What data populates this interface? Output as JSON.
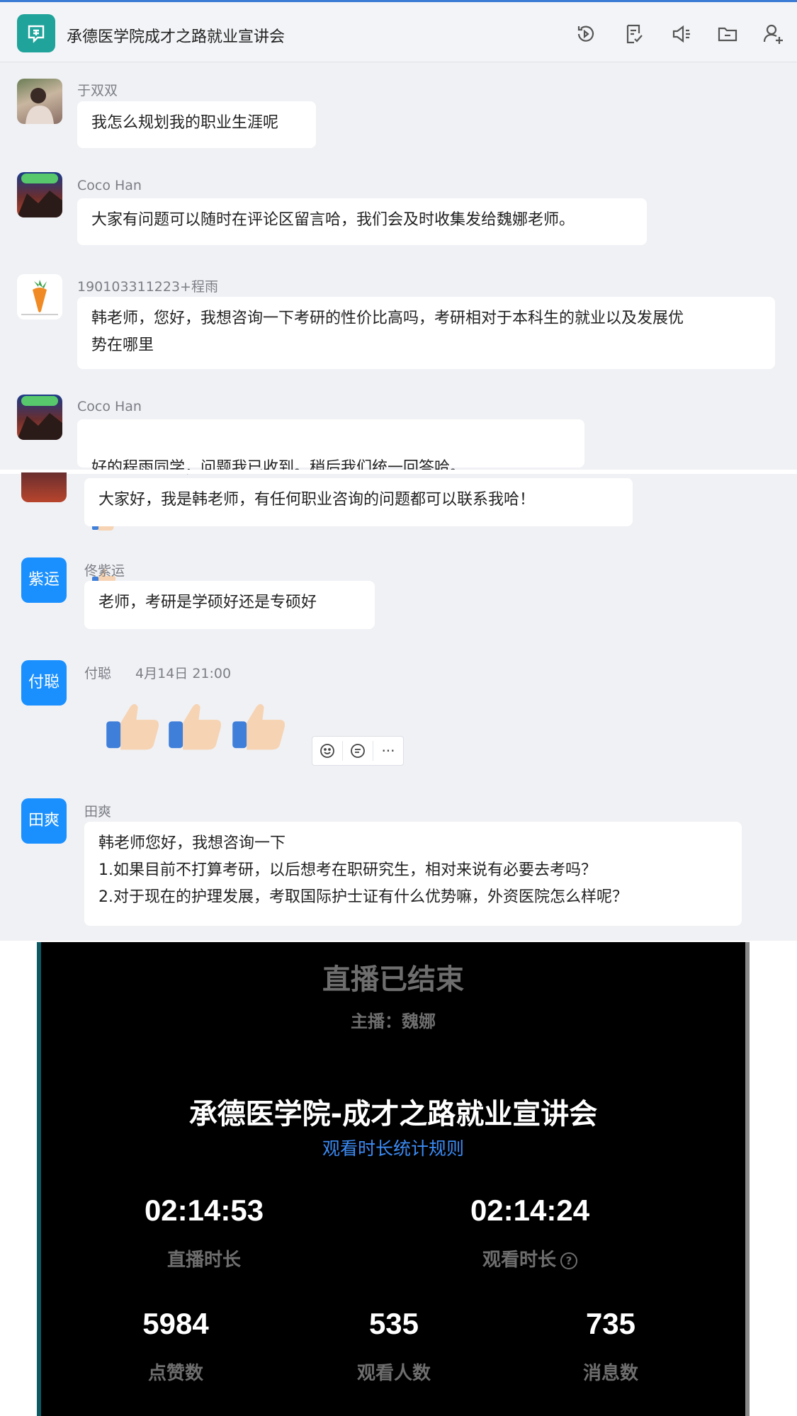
{
  "header": {
    "title": "承德医学院成才之路就业宣讲会",
    "icons": [
      "history-icon",
      "notes-icon",
      "announcement-icon",
      "folder-icon",
      "add-member-icon"
    ]
  },
  "messages": [
    {
      "sender": "于双双",
      "text": "我怎么规划我的职业生涯呢"
    },
    {
      "sender": "Coco Han",
      "text": "大家有问题可以随时在评论区留言哈，我们会及时收集发给魏娜老师。"
    },
    {
      "sender": "190103311223+程雨",
      "text": "韩老师，您好，我想咨询一下考研的性价比高吗，考研相对于本科生的就业以及发展优\n势在哪里"
    },
    {
      "sender": "Coco Han",
      "text": "好的程雨同学，问题我已收到。稍后我们统一回答哈。"
    },
    {
      "sender": "",
      "text": "大家好，我是韩老师，有任何职业咨询的问题都可以联系我哈！"
    },
    {
      "sender": "佟紫运",
      "avatar_text": "紫运",
      "text": "老师，考研是学硕好还是专硕好"
    },
    {
      "sender": "付聪",
      "avatar_text": "付聪",
      "timestamp": "4月14日 21:00",
      "text": ""
    },
    {
      "sender": "田爽",
      "avatar_text": "田爽",
      "text": "韩老师您好，我想咨询一下\n1.如果目前不打算考研，以后想考在职研究生，相对来说有必要去考吗？\n2.对于现在的护理发展，考取国际护士证有什么优势嘛，外资医院怎么样呢？"
    }
  ],
  "hover_actions": [
    "emoji-react-icon",
    "reply-icon",
    "more-icon"
  ],
  "hover_more_label": "···",
  "live": {
    "status": "直播已结束",
    "host": "主播：魏娜",
    "title": "承德医学院-成才之路就业宣讲会",
    "rules_link": "观看时长统计规则",
    "stats": {
      "live_duration": {
        "value": "02:14:53",
        "label": "直播时长"
      },
      "watch_duration": {
        "value": "02:14:24",
        "label": "观看时长"
      },
      "likes": {
        "value": "5984",
        "label": "点赞数"
      },
      "viewers": {
        "value": "535",
        "label": "观看人数"
      },
      "messages": {
        "value": "735",
        "label": "消息数"
      }
    },
    "help_glyph": "?"
  },
  "colors": {
    "accent": "#1a90ff",
    "group_icon": "#1fa39b",
    "link": "#3b8bf5"
  }
}
